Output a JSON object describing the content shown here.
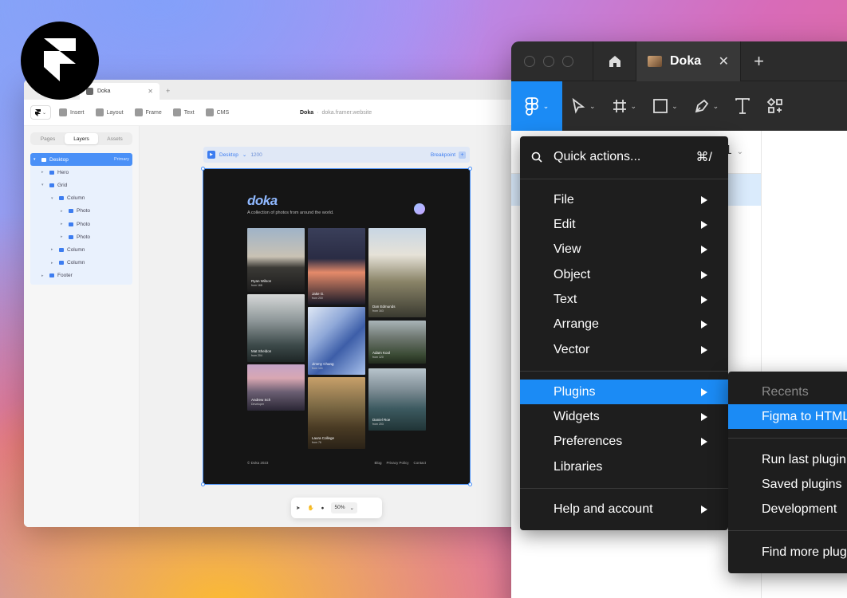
{
  "framer": {
    "tab_title": "Doka",
    "toolbar": {
      "insert": "Insert",
      "layout": "Layout",
      "frame": "Frame",
      "text": "Text",
      "cms": "CMS",
      "project": "Doka",
      "url": "doka.framer.website"
    },
    "sidebar_tabs": [
      "Pages",
      "Layers",
      "Assets"
    ],
    "layers": [
      {
        "label": "Desktop",
        "tag": "Primary"
      },
      {
        "label": "Hero"
      },
      {
        "label": "Grid"
      },
      {
        "label": "Column"
      },
      {
        "label": "Photo"
      },
      {
        "label": "Photo"
      },
      {
        "label": "Photo"
      },
      {
        "label": "Column"
      },
      {
        "label": "Column"
      },
      {
        "label": "Footer"
      }
    ],
    "breakpoint_bar": {
      "name": "Desktop",
      "width": "1200",
      "action": "Breakpoint"
    },
    "site": {
      "logo": "doka",
      "tagline": "A collection of photos from around the world.",
      "captions": [
        {
          "name": "Ryan Wilson",
          "sub": "from 168"
        },
        {
          "name": "Jake G.",
          "sub": "from 200"
        },
        {
          "name": "Dan Edmunds",
          "sub": "from 163"
        },
        {
          "name": "Mat Sheldon",
          "sub": "from 204"
        },
        {
          "name": "Jimmy Chang",
          "sub": "from 116"
        },
        {
          "name": "Adam Kool",
          "sub": "from 120"
        },
        {
          "name": "Andrew Sch",
          "sub": "Developer"
        },
        {
          "name": "Laura College",
          "sub": "from 76"
        },
        {
          "name": "Daniel Roe",
          "sub": "from 203"
        }
      ],
      "footer_copy": "© Doka 2023",
      "footer_links": [
        "Blog",
        "Privacy Policy",
        "Contact"
      ]
    },
    "zoom": "50%"
  },
  "figma": {
    "tab_title": "Doka",
    "page_indicator": "1",
    "menu": {
      "quick_actions": "Quick actions...",
      "quick_shortcut": "⌘/",
      "items": [
        "File",
        "Edit",
        "View",
        "Object",
        "Text",
        "Arrange",
        "Vector"
      ],
      "plugins": "Plugins",
      "widgets": "Widgets",
      "preferences": "Preferences",
      "libraries": "Libraries",
      "help": "Help and account"
    },
    "submenu": {
      "recents": "Recents",
      "recent_plugin": "Figma to HTML",
      "run_last": "Run last plugin",
      "saved": "Saved plugins",
      "development": "Development",
      "find_more": "Find more plugins"
    }
  },
  "colors": {
    "figma_accent": "#1b8bf5",
    "framer_accent": "#4a90f7",
    "menu_bg": "#1e1e1e"
  }
}
